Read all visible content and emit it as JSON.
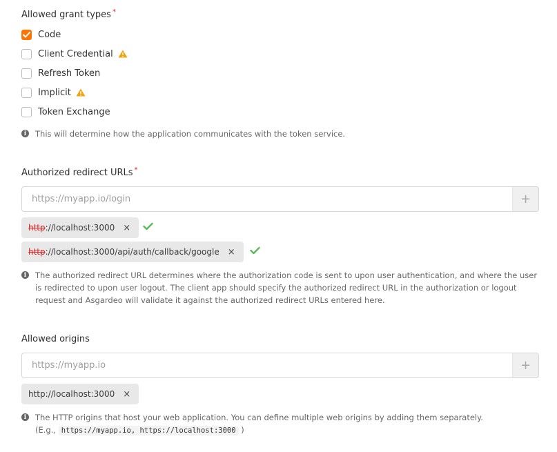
{
  "grant_types": {
    "label": "Allowed grant types",
    "required_mark": "*",
    "options": [
      {
        "label": "Code",
        "checked": true,
        "warning": false
      },
      {
        "label": "Client Credential",
        "checked": false,
        "warning": true
      },
      {
        "label": "Refresh Token",
        "checked": false,
        "warning": false
      },
      {
        "label": "Implicit",
        "checked": false,
        "warning": true
      },
      {
        "label": "Token Exchange",
        "checked": false,
        "warning": false
      }
    ],
    "hint": "This will determine how the application communicates with the token service."
  },
  "redirect_urls": {
    "label": "Authorized redirect URLs",
    "required_mark": "*",
    "placeholder": "https://myapp.io/login",
    "chips": [
      {
        "scheme": "http",
        "rest": "://localhost:3000",
        "remove": "×"
      },
      {
        "scheme": "http",
        "rest": "://localhost:3000/api/auth/callback/google",
        "remove": "×"
      }
    ],
    "hint_line1": "The authorized redirect URL determines where the authorization code is sent to upon user authentication, and where the user",
    "hint_line2": "is redirected to upon user logout. The client app should specify the authorized redirect URL in the authorization or logout",
    "hint_line3": "request and Asgardeo will validate it against the authorized redirect URLs entered here."
  },
  "origins": {
    "label": "Allowed origins",
    "placeholder": "https://myapp.io",
    "chips": [
      {
        "text": "http://localhost:3000",
        "remove": "×"
      }
    ],
    "hint_line1": "The HTTP origins that host your web application. You can define multiple web origins by adding them separately.",
    "hint_prefix": "(E.g.,",
    "hint_code": "https://myapp.io, https://localhost:3000",
    "hint_suffix": ")"
  },
  "add_symbol": "+",
  "info_symbol": "i",
  "colors": {
    "accent": "#ff7300",
    "success": "#5cb85c",
    "warning": "#f0a30a",
    "error": "#e02020"
  }
}
